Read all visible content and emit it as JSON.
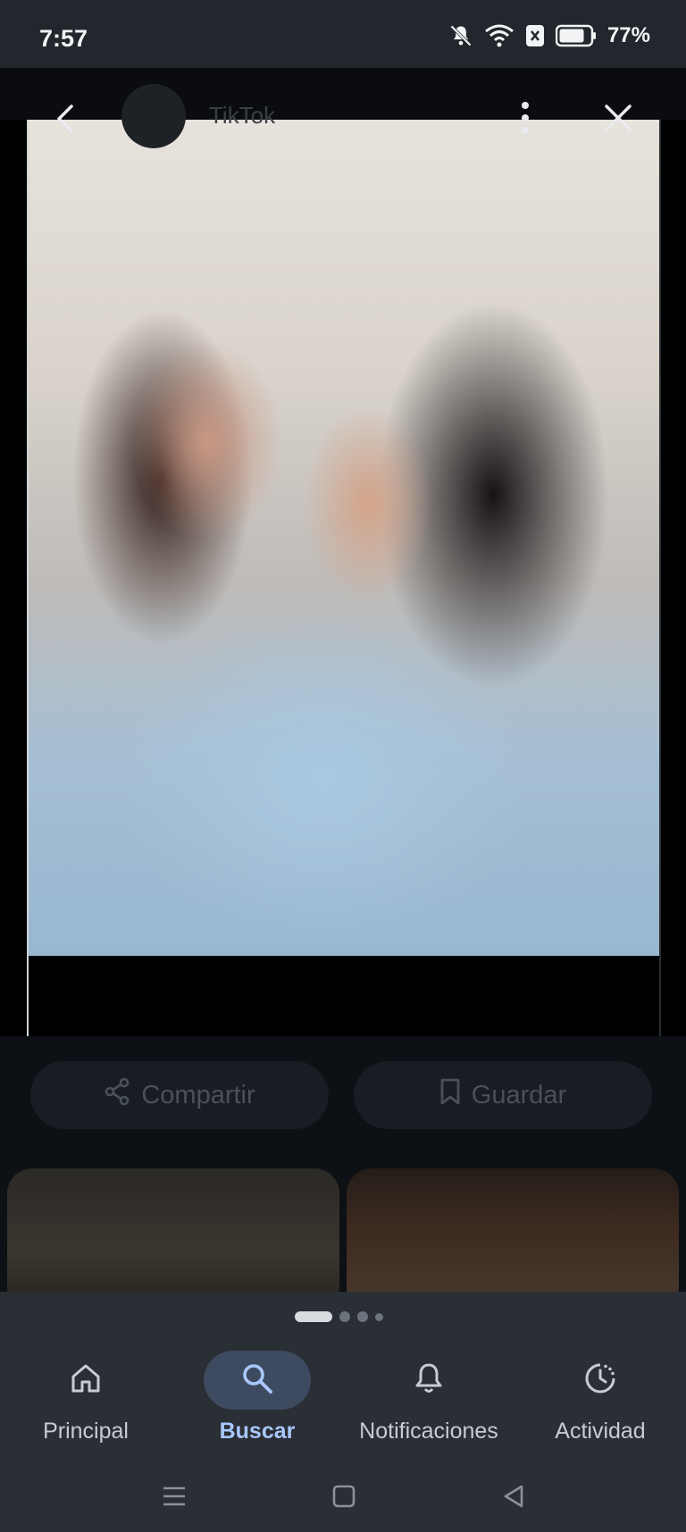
{
  "status_bar": {
    "time": "7:57",
    "battery_percent": "77%",
    "icons": [
      "bell-muted-icon",
      "wifi-icon",
      "sim-x-icon",
      "battery-icon"
    ]
  },
  "viewer": {
    "source_name": "TikTok",
    "icons": [
      "back-icon",
      "more-vert-icon",
      "close-icon"
    ]
  },
  "actions": {
    "share_label": "Compartir",
    "save_label": "Guardar"
  },
  "pager": {
    "count": 4,
    "active_index": 0
  },
  "bottom_nav": {
    "items": [
      {
        "label": "Principal",
        "icon": "home-icon",
        "active": false
      },
      {
        "label": "Buscar",
        "icon": "search-icon",
        "active": true
      },
      {
        "label": "Notificaciones",
        "icon": "bell-icon",
        "active": false
      },
      {
        "label": "Actividad",
        "icon": "activity-icon",
        "active": false
      }
    ]
  },
  "colors": {
    "accent": "#a8c7fa",
    "nav_active_bg": "#3d4a5f",
    "nav_bg": "#2a2e35"
  }
}
